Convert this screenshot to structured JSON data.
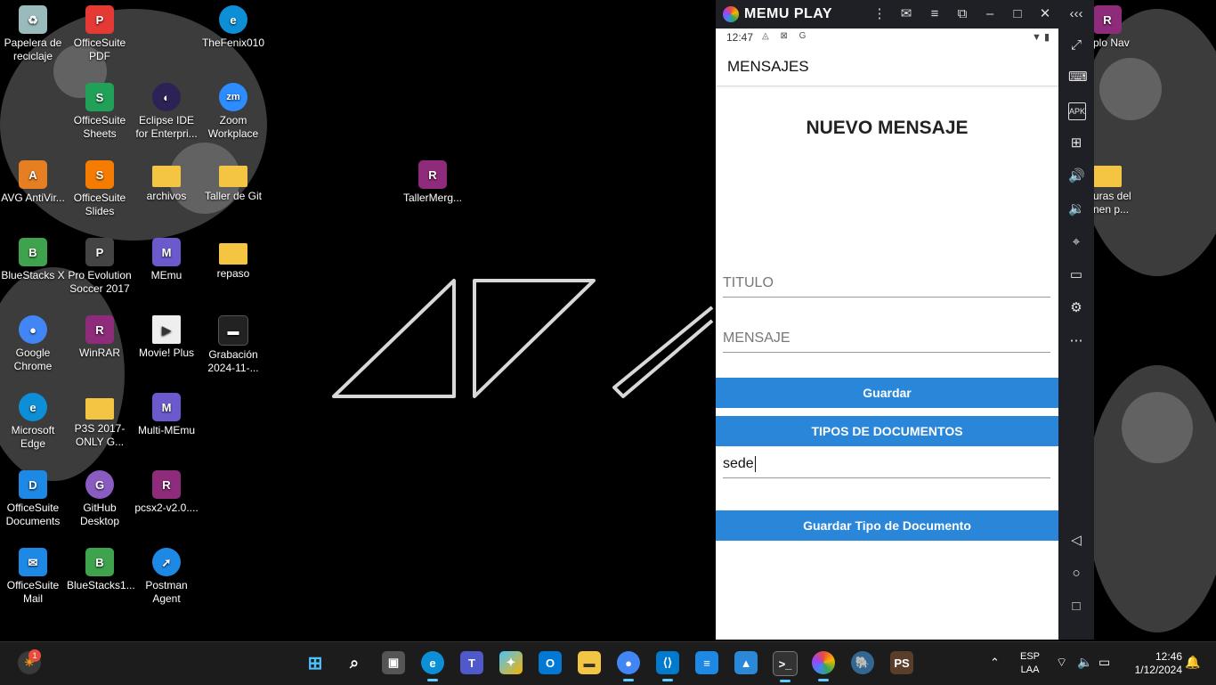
{
  "desktop": {
    "icons": [
      {
        "name": "recycle-bin",
        "label": "Papelera de reciclaje",
        "color": "#9bb",
        "glyph": "♻"
      },
      {
        "name": "officesuite-pdf",
        "label": "OfficeSuite PDF",
        "color": "#e53935",
        "glyph": "P"
      },
      {
        "name": "thefenix010",
        "label": "TheFenix010",
        "color": "#0c8fd6",
        "glyph": "e"
      },
      {
        "name": "officesuite-sheets",
        "label": "OfficeSuite Sheets",
        "color": "#21a058",
        "glyph": "S"
      },
      {
        "name": "eclipse-ide",
        "label": "Eclipse IDE for Enterpri...",
        "color": "#2c2255",
        "glyph": "◐"
      },
      {
        "name": "zoom-workplace",
        "label": "Zoom Workplace",
        "color": "#2d8cff",
        "glyph": "zm"
      },
      {
        "name": "avg-antivirus",
        "label": "AVG AntiVir...",
        "color": "#e67e22",
        "glyph": "A"
      },
      {
        "name": "officesuite-slides",
        "label": "OfficeSuite Slides",
        "color": "#f57c00",
        "glyph": "S"
      },
      {
        "name": "archivos",
        "label": "archivos",
        "color": "#f4c542",
        "glyph": ""
      },
      {
        "name": "taller-de-git",
        "label": "Taller de Git",
        "color": "#f4c542",
        "glyph": ""
      },
      {
        "name": "taller-merge",
        "label": "TallerMerg...",
        "color": "#8e2b7a",
        "glyph": "R"
      },
      {
        "name": "bluestacks-x",
        "label": "BlueStacks X",
        "color": "#3fa34d",
        "glyph": "B"
      },
      {
        "name": "pes-2017",
        "label": "Pro Evolution Soccer 2017",
        "color": "#444",
        "glyph": "P"
      },
      {
        "name": "memu",
        "label": "MEmu",
        "color": "#6a5acd",
        "glyph": "M"
      },
      {
        "name": "repaso",
        "label": "repaso",
        "color": "#f4c542",
        "glyph": ""
      },
      {
        "name": "google-chrome",
        "label": "Google Chrome",
        "color": "#4285f4",
        "glyph": "●"
      },
      {
        "name": "winrar",
        "label": "WinRAR",
        "color": "#8e2b7a",
        "glyph": "R"
      },
      {
        "name": "movie-plus",
        "label": "Movie! Plus",
        "color": "#eee",
        "glyph": "▶"
      },
      {
        "name": "grabacion",
        "label": "Grabación 2024-11-...",
        "color": "#222",
        "glyph": "▬"
      },
      {
        "name": "microsoft-edge",
        "label": "Microsoft Edge",
        "color": "#0c8fd6",
        "glyph": "e"
      },
      {
        "name": "p3s-2017",
        "label": "P3S 2017-ONLY G...",
        "color": "#f4c542",
        "glyph": ""
      },
      {
        "name": "multi-memu",
        "label": "Multi-MEmu",
        "color": "#6a5acd",
        "glyph": "M"
      },
      {
        "name": "officesuite-documents",
        "label": "OfficeSuite Documents",
        "color": "#1e88e5",
        "glyph": "D"
      },
      {
        "name": "github-desktop",
        "label": "GitHub Desktop",
        "color": "#8a5cc2",
        "glyph": "G"
      },
      {
        "name": "pcsx2",
        "label": "pcsx2-v2.0....",
        "color": "#8e2b7a",
        "glyph": "R"
      },
      {
        "name": "officesuite-mail",
        "label": "OfficeSuite Mail",
        "color": "#1e88e5",
        "glyph": "✉"
      },
      {
        "name": "bluestacks1",
        "label": "BlueStacks1...",
        "color": "#3fa34d",
        "glyph": "B"
      },
      {
        "name": "postman-agent",
        "label": "Postman Agent",
        "color": "#1e88e5",
        "glyph": "➚"
      },
      {
        "name": "winrar-right",
        "label": "plo Nav",
        "color": "#8e2b7a",
        "glyph": "R"
      },
      {
        "name": "folder-right",
        "label": "uras del nen p...",
        "color": "#f4c542",
        "glyph": ""
      }
    ]
  },
  "emulator": {
    "brand": "MEMU PLAY",
    "status_time": "12:47",
    "status_icons": "◬ ⊠ G",
    "status_right": "▼ ▮",
    "app_title": "MENSAJES",
    "heading": "NUEVO MENSAJE",
    "titulo_placeholder": "TITULO",
    "mensaje_placeholder": "MENSAJE",
    "guardar_label": "Guardar",
    "tipos_label": "TIPOS DE DOCUMENTOS",
    "tipo_value": "sede",
    "guardar_tipo_label": "Guardar Tipo de Documento",
    "accent": "#2a86d9"
  },
  "taskbar": {
    "notification_count": "1",
    "lang_1": "ESP",
    "lang_2": "LAA",
    "time": "12:46",
    "date": "1/12/2024"
  }
}
